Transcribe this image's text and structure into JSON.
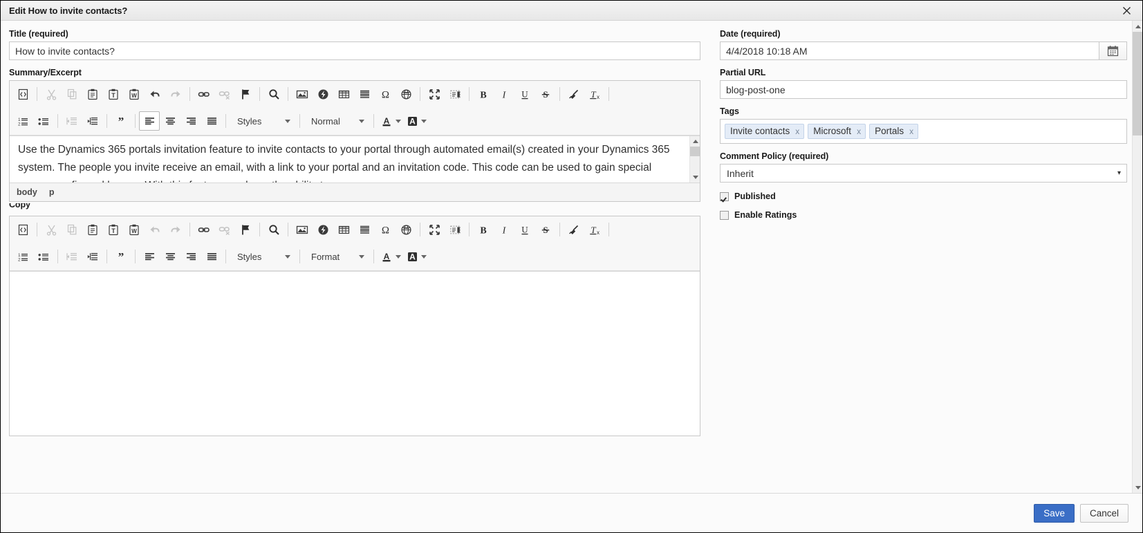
{
  "window": {
    "title": "Edit How to invite contacts?",
    "close_icon": "close-icon"
  },
  "left": {
    "title_label": "Title (required)",
    "title_value": "How to invite contacts?",
    "title_placeholder": "",
    "summary_label": "Summary/Excerpt",
    "summary_text": "Use the Dynamics 365 portals invitation feature to invite contacts to your portal through automated email(s) created in your Dynamics 365 system. The people you invite receive an email, with a link to your portal and an invitation code. This code can be used to gain special access configured by you. With this feature you have the ability to:",
    "summary_path": [
      "body",
      "p"
    ],
    "copy_label": "Copy",
    "copy_text": ""
  },
  "toolbar": {
    "styles_label": "Styles",
    "format_normal_label": "Normal",
    "format_label": "Format",
    "buttons_row1": [
      {
        "name": "source-icon",
        "title": "Source"
      },
      {
        "name": "cut-icon",
        "title": "Cut"
      },
      {
        "name": "copy-icon",
        "title": "Copy"
      },
      {
        "name": "paste-icon",
        "title": "Paste"
      },
      {
        "name": "paste-as-text-icon",
        "title": "Paste as plain text"
      },
      {
        "name": "paste-from-word-icon",
        "title": "Paste from Word"
      },
      {
        "name": "undo-icon",
        "title": "Undo"
      },
      {
        "name": "redo-icon",
        "title": "Redo"
      },
      {
        "name": "link-icon",
        "title": "Link"
      },
      {
        "name": "unlink-icon",
        "title": "Unlink"
      },
      {
        "name": "anchor-flag-icon",
        "title": "Anchor"
      },
      {
        "name": "find-icon",
        "title": "Find"
      },
      {
        "name": "image-icon",
        "title": "Image"
      },
      {
        "name": "flash-icon",
        "title": "Flash"
      },
      {
        "name": "table-icon",
        "title": "Table"
      },
      {
        "name": "horizontal-rule-icon",
        "title": "Horizontal Line"
      },
      {
        "name": "special-char-icon",
        "title": "Insert Special Character"
      },
      {
        "name": "iframe-icon",
        "title": "IFrame"
      },
      {
        "name": "maximize-icon",
        "title": "Maximize"
      },
      {
        "name": "show-blocks-icon",
        "title": "Show Blocks"
      },
      {
        "name": "bold-icon",
        "title": "Bold"
      },
      {
        "name": "italic-icon",
        "title": "Italic"
      },
      {
        "name": "underline-icon",
        "title": "Underline"
      },
      {
        "name": "strikethrough-icon",
        "title": "Strikethrough"
      },
      {
        "name": "remove-format-icon",
        "title": "Remove Format"
      },
      {
        "name": "clear-text-format-icon",
        "title": "Clear Formatting"
      }
    ],
    "buttons_row2": [
      {
        "name": "numbered-list-icon",
        "title": "Insert/Remove Numbered List"
      },
      {
        "name": "bulleted-list-icon",
        "title": "Insert/Remove Bulleted List"
      },
      {
        "name": "outdent-icon",
        "title": "Decrease Indent"
      },
      {
        "name": "indent-icon",
        "title": "Increase Indent"
      },
      {
        "name": "blockquote-icon",
        "title": "Block Quote"
      },
      {
        "name": "align-left-icon",
        "title": "Align Left"
      },
      {
        "name": "align-center-icon",
        "title": "Center"
      },
      {
        "name": "align-right-icon",
        "title": "Align Right"
      },
      {
        "name": "align-justify-icon",
        "title": "Justify"
      },
      {
        "name": "text-color-icon",
        "title": "Text Color"
      },
      {
        "name": "background-color-icon",
        "title": "Background Color"
      }
    ]
  },
  "right": {
    "date_label": "Date (required)",
    "date_value": "4/4/2018 10:18 AM",
    "calendar_icon": "calendar-icon",
    "url_label": "Partial URL",
    "url_value": "blog-post-one",
    "tags_label": "Tags",
    "tags": [
      {
        "label": "Invite contacts",
        "remove": "x"
      },
      {
        "label": "Microsoft",
        "remove": "x"
      },
      {
        "label": "Portals",
        "remove": "x"
      }
    ],
    "comment_policy_label": "Comment Policy (required)",
    "comment_policy_value": "Inherit",
    "comment_policy_caret": "▾",
    "published_label": "Published",
    "published_checked": true,
    "ratings_label": "Enable Ratings",
    "ratings_checked": false
  },
  "footer": {
    "save_label": "Save",
    "cancel_label": "Cancel"
  },
  "colors": {
    "accent": "#3a6ec6",
    "tag_bg": "#e4ecf7",
    "toolbar_bg": "#f7f7f7",
    "window_bg": "#fbfbfb"
  }
}
